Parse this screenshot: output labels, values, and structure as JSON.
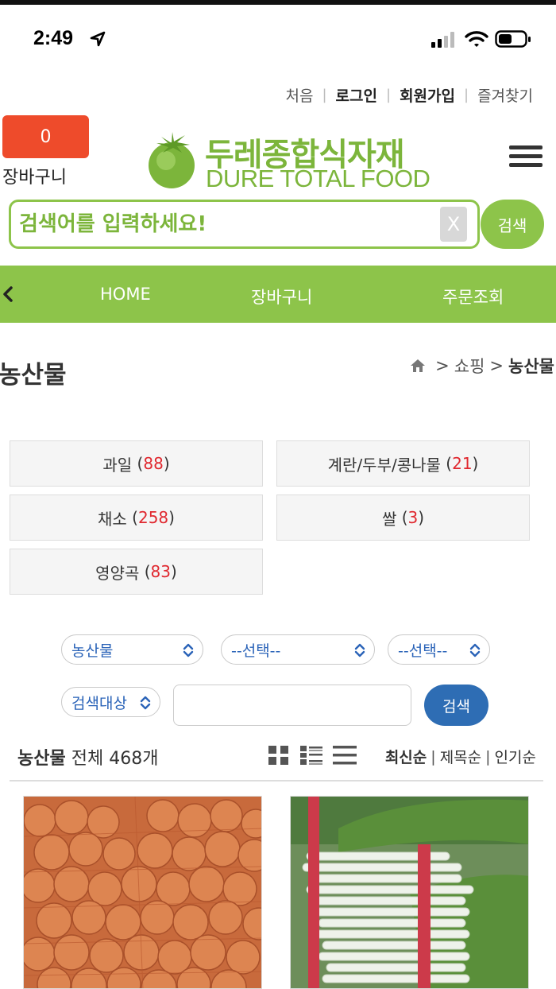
{
  "status_bar": {
    "time": "2:49"
  },
  "top_links": [
    "처음",
    "로그인",
    "회원가입",
    "즐겨찾기"
  ],
  "cart": {
    "count": "0",
    "label": "장바구니"
  },
  "logo": {
    "korean": "두레종합식자재",
    "english": "DURE TOTAL FOOD"
  },
  "search": {
    "placeholder": "검색어를 입력하세요!",
    "clear_label": "X",
    "button_label": "검색"
  },
  "nav": {
    "items": [
      "HOME",
      "장바구니",
      "주문조회"
    ]
  },
  "page": {
    "title": "농산물"
  },
  "breadcrumb": {
    "shop": "쇼핑",
    "current": "농산물",
    "sep": ">"
  },
  "categories": [
    {
      "name": "과일",
      "count": "88"
    },
    {
      "name": "계란/두부/콩나물",
      "count": "21"
    },
    {
      "name": "채소",
      "count": "258"
    },
    {
      "name": "쌀",
      "count": "3"
    },
    {
      "name": "영양곡",
      "count": "83"
    }
  ],
  "filters": {
    "category_select": "농산물",
    "sub_select_1": "--선택--",
    "sub_select_2": "--선택--",
    "target_select": "검색대상",
    "keyword_value": "",
    "search_button": "검색"
  },
  "list": {
    "category": "농산물",
    "total_text": "전체 468개",
    "sorts": [
      "최신순",
      "제목순",
      "인기순"
    ]
  },
  "colors": {
    "brand_green": "#8dc44a",
    "cart_red": "#ee4b2b",
    "button_blue": "#2e6db4",
    "count_red": "#e0282f"
  }
}
